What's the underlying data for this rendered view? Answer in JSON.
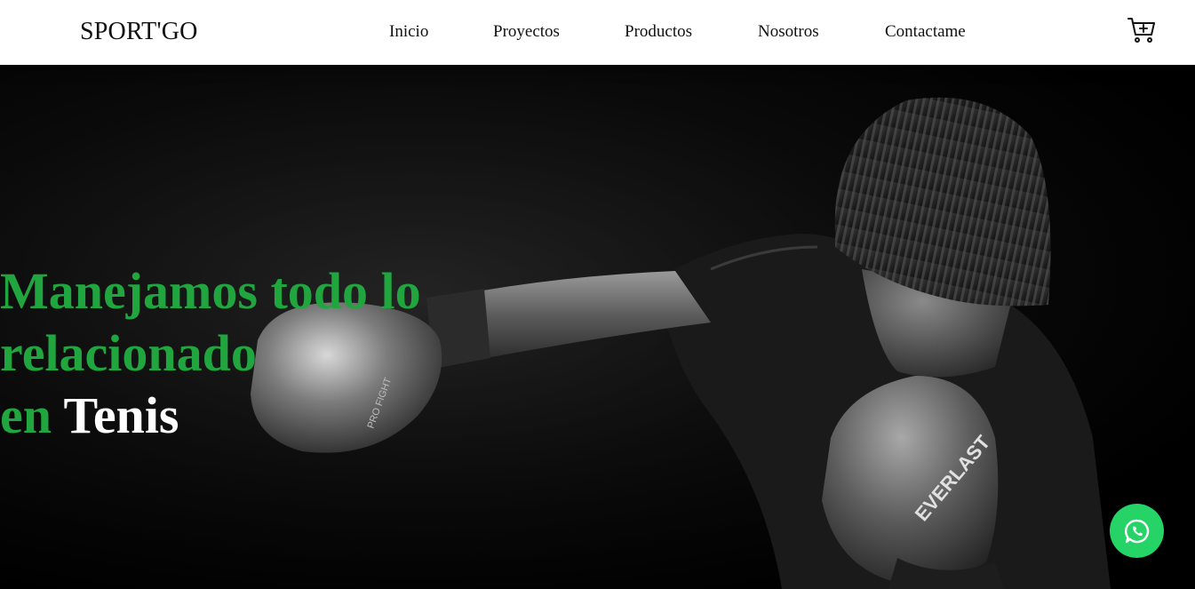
{
  "brand": {
    "name": "SPORT'GO"
  },
  "nav": {
    "items": [
      {
        "label": "Inicio"
      },
      {
        "label": "Proyectos"
      },
      {
        "label": "Productos"
      },
      {
        "label": "Nosotros"
      },
      {
        "label": "Contactame"
      }
    ],
    "cart_icon": "shopping-cart-plus-icon"
  },
  "hero": {
    "line1": "Manejamos todo lo",
    "line2": "relacionado",
    "line3_prefix": "en",
    "line3_highlight": "Tenis",
    "accent_color": "#21a53f",
    "highlight_color": "#ffffff",
    "glove_front_text": "EVERLAST",
    "glove_back_text": "PRO FIGHT"
  },
  "floating": {
    "whatsapp_icon": "whatsapp-icon",
    "whatsapp_color": "#25d366"
  }
}
